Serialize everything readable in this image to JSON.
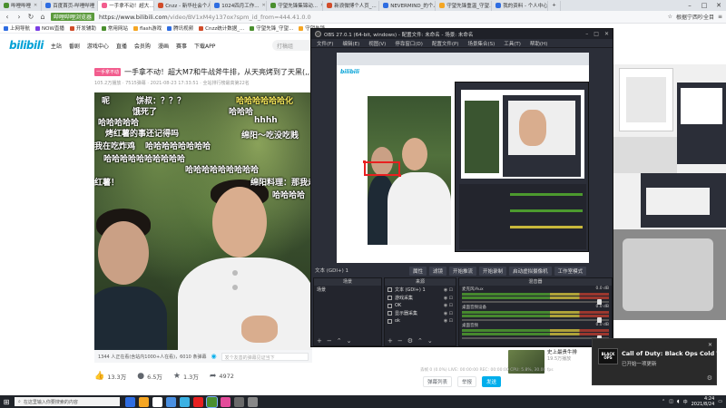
{
  "browser": {
    "tabs": [
      {
        "label": "哔哩哔哩",
        "color": "#4a8f2e",
        "active": false
      },
      {
        "label": "百度首页-哔哩哔哩",
        "color": "#2f6de1",
        "active": false
      },
      {
        "label": "一手拿不动！超大...",
        "color": "#f25d8e",
        "active": true
      },
      {
        "label": "Cnzz - 新华社会个人...",
        "color": "#d14c2a",
        "active": false
      },
      {
        "label": "1024四月工作...",
        "color": "#2f6de1",
        "active": false
      },
      {
        "label": "守望先锋集锦动...",
        "color": "#4a8f2e",
        "active": false
      },
      {
        "label": "新浪微博个人页_...",
        "color": "#d14c2a",
        "active": false
      },
      {
        "label": "NEVERMIND_的个人...",
        "color": "#2f6de1",
        "active": false
      },
      {
        "label": "守望先锋重温_守望...",
        "color": "#f5a623",
        "active": false
      },
      {
        "label": "我的资料 - 个人中心",
        "color": "#2f6de1",
        "active": false
      }
    ],
    "bookmark_app_label": "哔哩哔哩浏览器",
    "url_host": "https://www.bilibili.com",
    "url_path": "/video/BV1xM4y137ox?spm_id_from=444.41.0.0",
    "address_right": "根据宁西吵全目",
    "bookmarks": [
      {
        "label": "上网导航",
        "color": "#2f6de1"
      },
      {
        "label": "NOW直播",
        "color": "#7b3fe4"
      },
      {
        "label": "开发辅助",
        "color": "#d14c2a"
      },
      {
        "label": "常用网站",
        "color": "#4a8f2e"
      },
      {
        "label": "flash游戏",
        "color": "#f5a623"
      },
      {
        "label": "腾讯视频",
        "color": "#2f6de1"
      },
      {
        "label": "Cnzz统计数据_...",
        "color": "#d14c2a"
      },
      {
        "label": "守望先锋_守望...",
        "color": "#4a8f2e"
      },
      {
        "label": "守望先锋...",
        "color": "#f5a623"
      }
    ]
  },
  "bili": {
    "logo": "bilibili",
    "nav": [
      "主站",
      "番剧",
      "游戏中心",
      "直播",
      "会员购",
      "漫画",
      "赛事",
      "下载APP"
    ],
    "search_placeholder": "打稿组",
    "title_badge": "一手拿不动",
    "video_title": "一手拿不动！超大M7和牛战斧牛排，从天亮烤到了天黑(,,•̀_•́,,)",
    "video_meta": "105.2万播放 · 7515弹幕 · 2021-08-23 17:33:51 · 全站排行榜最高第22名",
    "danmaku": [
      {
        "text": "呢",
        "color": "w"
      },
      {
        "text": "饼叔：？？？",
        "color": "w"
      },
      {
        "text": "饿死了",
        "color": "w"
      },
      {
        "text": "哈哈哈哈哈哈化",
        "color": "y"
      },
      {
        "text": "哈哈哈",
        "color": "w"
      },
      {
        "text": "哈哈哈哈哈",
        "color": "w"
      },
      {
        "text": "hhhh",
        "color": "w"
      },
      {
        "text": "烤红薯的事还记得吗",
        "color": "w"
      },
      {
        "text": "绵阳～吃没吃贱",
        "color": "w"
      },
      {
        "text": "我在吃炸鸡",
        "color": "w"
      },
      {
        "text": "哈哈哈哈哈哈哈哈",
        "color": "w"
      },
      {
        "text": "哈哈哈哈哈哈哈哈哈哈",
        "color": "w"
      },
      {
        "text": "哈哈哈哈哈哈哈哈哈",
        "color": "w"
      },
      {
        "text": "红薯！",
        "color": "w"
      },
      {
        "text": "绵阳料理：那我走",
        "color": "w"
      },
      {
        "text": "哈哈哈哈",
        "color": "w"
      }
    ],
    "danmaku_count": "1344 人正在看(含站内1000+人在看)，6010 条弹幕",
    "danmaku_input_placeholder": "发个友善的弹幕见证当下",
    "actions": [
      {
        "icon": "like-icon",
        "glyph": "👍",
        "label": "13.3万"
      },
      {
        "icon": "coin-icon",
        "glyph": "●",
        "label": "6.5万"
      },
      {
        "icon": "star-icon",
        "glyph": "★",
        "label": "1.3万"
      },
      {
        "icon": "share-icon",
        "glyph": "➦",
        "label": "4972"
      }
    ],
    "right_buttons": [
      "弹幕列表",
      "举报",
      "发送"
    ],
    "related": [
      {
        "title": "男子在家用烤箱做",
        "sub": "排！现惊呆...",
        "meta": "超仔仔 2.4万播"
      },
      {
        "title": "史上最贵牛排",
        "sub": "",
        "meta": "19.5万播放"
      }
    ]
  },
  "obs": {
    "title": "OBS 27.0.1 (64-bit, windows) - 配置文件: 未命名 - 场景: 未命名",
    "menu": [
      "文件(F)",
      "编辑(E)",
      "视图(V)",
      "停靠窗口(D)",
      "配置文件(P)",
      "场景集合(S)",
      "工具(T)",
      "帮助(H)"
    ],
    "scene_label": "文本 (GDI+) 1",
    "toolbar_chips": [
      "属性",
      "滤镜",
      "开始推流",
      "开始录制",
      "启动虚拟摄像机",
      "工作室模式"
    ],
    "panels": {
      "scenes": {
        "title": "场景",
        "items": [
          "场景"
        ]
      },
      "sources": {
        "title": "来源",
        "items": [
          "文本 (GDI+) 1",
          "游戏采集",
          "OK",
          "显示器采集",
          "ok"
        ]
      },
      "mixer": {
        "title": "混音器",
        "channels": [
          {
            "name": "麦克风/Aux",
            "level": "0.0 dB"
          },
          {
            "name": "桌面音频设备",
            "level": "0.0 dB"
          },
          {
            "name": "桌面音频",
            "level": "0.0 dB"
          }
        ]
      }
    },
    "status": "丢帧 0 (0.0%)  LIVE: 00:00:00  REC: 00:00:00  CPU: 5.8%, 30.00 fps"
  },
  "notification": {
    "app_icon_text": "BLACK OPS",
    "title": "Call of Duty: Black Ops Cold War",
    "body": "已开始一项更新",
    "close": "✕",
    "header_label": "通知"
  },
  "taskbar": {
    "search_placeholder": "在这里输入你要搜索的内容",
    "time": "4:24",
    "date": "2021/8/24",
    "lang": "中",
    "icons": [
      "#2f6de1",
      "#f5a623",
      "#ffffff",
      "#4a90e2",
      "#3bb1e3",
      "#e82020",
      "#4a8f2e",
      "#e34b9a",
      "#6a6a6a",
      "#888888"
    ]
  }
}
